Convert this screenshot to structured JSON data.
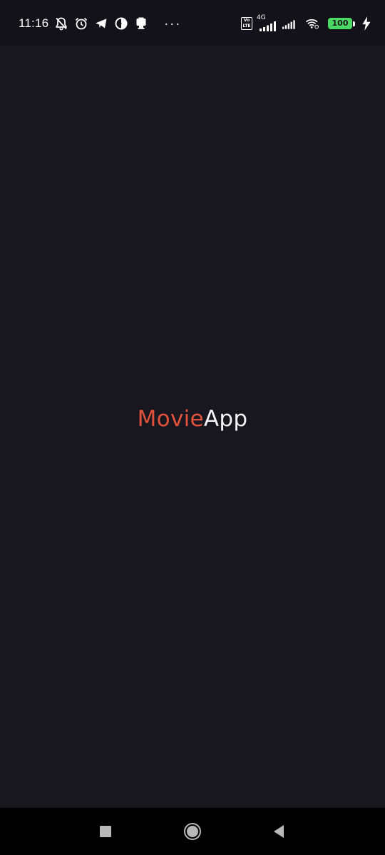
{
  "status_bar": {
    "time": "11:16",
    "left_icons": [
      "notifications-muted-icon",
      "alarm-icon",
      "telegram-icon",
      "data-saver-icon",
      "clipboard-icon"
    ],
    "overflow": "···",
    "volte": "Vo LTE",
    "network_type": "4G",
    "battery_level": "100",
    "charging": true,
    "colors": {
      "battery": "#4cd964",
      "background": "#13121a"
    }
  },
  "splash": {
    "title_part1": "Movie",
    "title_part2": "App",
    "colors": {
      "background": "#181720",
      "accent": "#e0523c",
      "title_secondary": "#f2f2f2"
    }
  },
  "nav_bar": {
    "buttons": [
      "recents-button",
      "home-button",
      "back-button"
    ]
  }
}
